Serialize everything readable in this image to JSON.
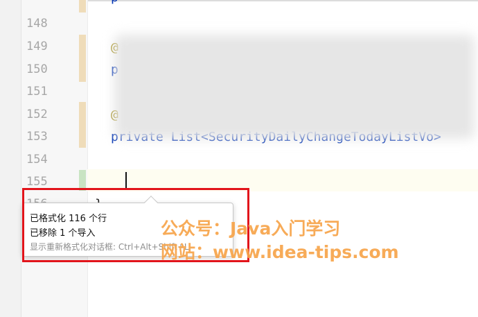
{
  "editor": {
    "line_numbers": [
      "148",
      "149",
      "150",
      "151",
      "152",
      "153",
      "154",
      "155",
      "156"
    ],
    "code_lines": {
      "line149_start": "@",
      "line150_start": "p",
      "line152_start": "@",
      "line153": "private List<SecurityDailyChangeTodayListVo>",
      "line156": "}"
    }
  },
  "popup": {
    "line1": "已格式化 116 个行",
    "line2": "已移除 1 个导入",
    "hint": "显示重新格式化对话框: Ctrl+Alt+Shift+L"
  },
  "watermark": {
    "line1": "公众号：Java入门学习",
    "line2": "网站：www.idea-tips.com"
  },
  "colors": {
    "accent_red": "#e2141b",
    "watermark": "#f7a44a",
    "keyword": "#0033b3",
    "annotation": "#9e880d"
  }
}
